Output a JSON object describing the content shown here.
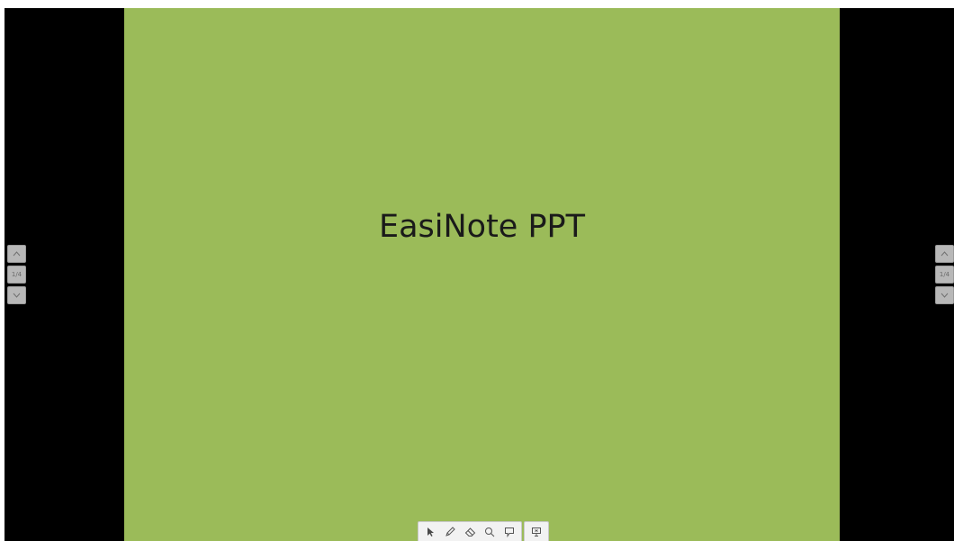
{
  "slide": {
    "title": "EasiNote PPT",
    "background_color": "#9bbb59"
  },
  "pager_left": {
    "prev_icon": "chevron-up-icon",
    "page_label": "1/4",
    "next_icon": "chevron-down-icon"
  },
  "pager_right": {
    "prev_icon": "chevron-up-icon",
    "page_label": "1/4",
    "next_icon": "chevron-down-icon"
  },
  "toolbar": {
    "tools": [
      "select-arrow-icon",
      "pen-icon",
      "eraser-icon",
      "search-icon",
      "comment-icon"
    ],
    "end_show_icon": "end-slideshow-icon"
  }
}
